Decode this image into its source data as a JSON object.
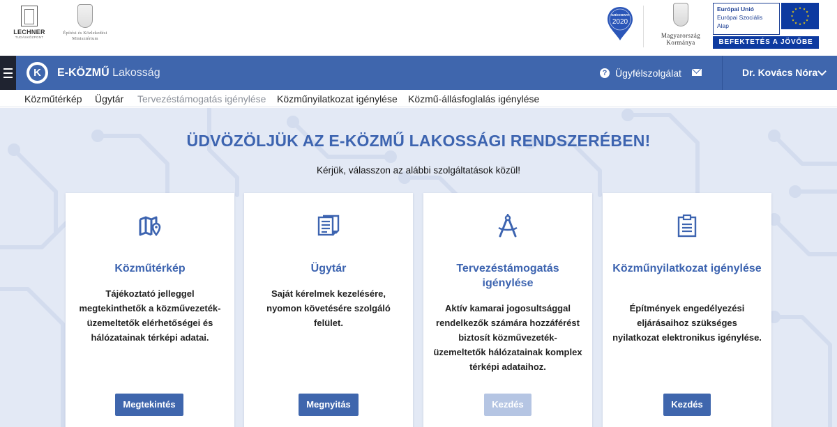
{
  "logos": {
    "lechner_name": "LECHNER",
    "lechner_sub": "TUDÁSKÖZPONT",
    "ministry_line1": "Építési és Közlekedési",
    "ministry_line2": "Minisztérium",
    "szechenyi_top": "SZÉCHENYI",
    "szechenyi_year": "2020",
    "kormany_line1": "Magyarország",
    "kormany_line2": "Kormánya",
    "eu_line1": "Európai Unió",
    "eu_line2": "Európai Szociális",
    "eu_line3": "Alap",
    "eu_invest": "BEFEKTETÉS A JÖVŐBE"
  },
  "appbar": {
    "brand_bold": "E-KÖZMŰ",
    "brand_thin": "Lakosság",
    "brand_logo_letter": "K",
    "support_label": "Ügyfélszolgálat",
    "user_name": "Dr. Kovács Nóra"
  },
  "subnav": {
    "items": [
      {
        "label": "Közműtérkép"
      },
      {
        "label": "Ügytár"
      },
      {
        "label": "Tervezéstámogatás igénylése"
      },
      {
        "label": "Közműnyilatkozat igénylése"
      },
      {
        "label": "Közmű-állásfoglalás igénylése"
      }
    ]
  },
  "hero": {
    "title": "ÜDVÖZÖLJÜK AZ E-KÖZMŰ LAKOSSÁGI RENDSZERÉBEN!",
    "subtitle": "Kérjük, válasszon az alábbi szolgáltatások közül!"
  },
  "cards": [
    {
      "icon": "map-icon",
      "title": "Közműtérkép",
      "description": "Tájékoztató jelleggel megtekinthetők a közművezeték-üzemeltetők elérhetőségei és hálózatainak térképi adatai.",
      "button": "Megtekintés",
      "enabled": true
    },
    {
      "icon": "document-icon",
      "title": "Ügytár",
      "description": "Saját kérelmek kezelésére, nyomon követésére szolgáló felület.",
      "button": "Megnyitás",
      "enabled": true
    },
    {
      "icon": "compass-icon",
      "title": "Tervezéstámogatás igénylése",
      "description": "Aktív kamarai jogosultsággal rendelkezők számára hozzáférést biztosít közművezeték-üzemeltetők hálózatainak komplex térképi adataihoz.",
      "button": "Kezdés",
      "enabled": false
    },
    {
      "icon": "clipboard-icon",
      "title": "Közműnyilatkozat igénylése",
      "description": "Építmények engedélyezési eljárásaihoz szükséges nyilatkozat elektronikus igénylése.",
      "button": "Kezdés",
      "enabled": true
    }
  ],
  "colors": {
    "primary": "#3f66ad",
    "title_blue": "#3d64b0",
    "hero_bg": "#e3e9f5",
    "disabled_button": "#b5c5e3",
    "dark_menu": "#1f2330"
  }
}
